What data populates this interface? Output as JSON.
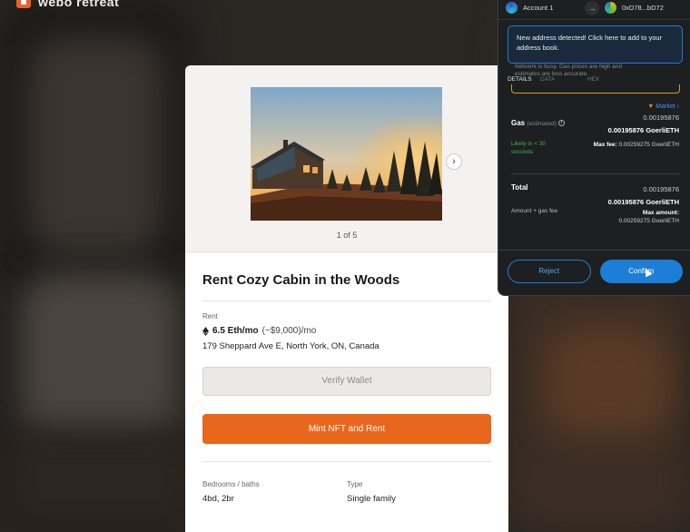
{
  "app": {
    "logo_text": "webo retreat",
    "brand_color": "#e8671c"
  },
  "listing": {
    "photo_counter": "1 of 5",
    "title": "Rent Cozy Cabin in the Woods",
    "rent_label": "Rent",
    "price_eth": "6.5 Eth/mo",
    "price_usd": "(~$9,000)/mo",
    "address": "179 Sheppard Ave E, North York, ON, Canada",
    "verify_button": "Verify Wallet",
    "mint_button": "Mint NFT and Rent",
    "specs": [
      {
        "label": "Bedrooms / baths",
        "value": "4bd, 2br"
      },
      {
        "label": "Type",
        "value": "Single family"
      }
    ]
  },
  "wallet": {
    "from_account": "Account 1",
    "to_address": "0xD78...bD72",
    "notice": "New address detected! Click here to add to your address book.",
    "ghost_text_1": "Network is busy. Gas prices are high and",
    "ghost_text_2": "estimates are less accurate.",
    "tabs": [
      "DETAILS",
      "DATA",
      "HEX"
    ],
    "market_label": "Market",
    "gas": {
      "label": "Gas",
      "estimated": "(estimated)",
      "amount": "0.00195876",
      "amount_bold": "0.00195876 GoerliETH",
      "likely": "Likely in < 30 seconds",
      "max_fee_label": "Max fee:",
      "max_fee": "0.00259275 GoerliETH"
    },
    "total": {
      "label": "Total",
      "amount": "0.00195876",
      "amount_bold": "0.00195876 GoerliETH",
      "sub_label": "Amount + gas fee",
      "max_amount_label": "Max amount:",
      "max_amount": "0.00259275 GoerliETH"
    },
    "reject_button": "Reject",
    "confirm_button": "Confirm"
  }
}
